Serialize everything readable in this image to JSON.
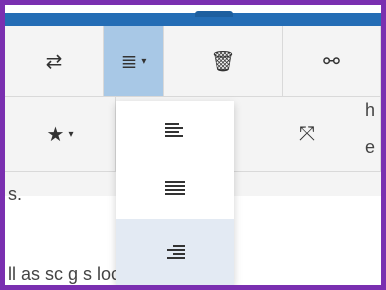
{
  "toolbar": {
    "row1": [
      {
        "name": "swap-icon",
        "glyph": "⇄"
      },
      {
        "name": "align-right-icon",
        "glyph": "≣",
        "has_caret": true,
        "caret": "▾"
      },
      {
        "name": "trash-icon",
        "glyph": "🗑"
      },
      {
        "name": "link-icon",
        "glyph": "⚯"
      }
    ],
    "row2": [
      {
        "name": "star-icon",
        "glyph": "★",
        "has_caret": true,
        "caret": "▾"
      },
      {
        "name": "expand-icon",
        "glyph": "⤧"
      }
    ]
  },
  "align_dropdown": {
    "items": [
      {
        "name": "align-left-icon"
      },
      {
        "name": "align-justify-icon"
      },
      {
        "name": "align-right-icon",
        "selected": true
      }
    ]
  },
  "background_text": {
    "right_fragment_1": "h",
    "right_fragment_2": "e",
    "fragment_s": "s.",
    "bottom_line": "ll as sc      g      s located be"
  }
}
